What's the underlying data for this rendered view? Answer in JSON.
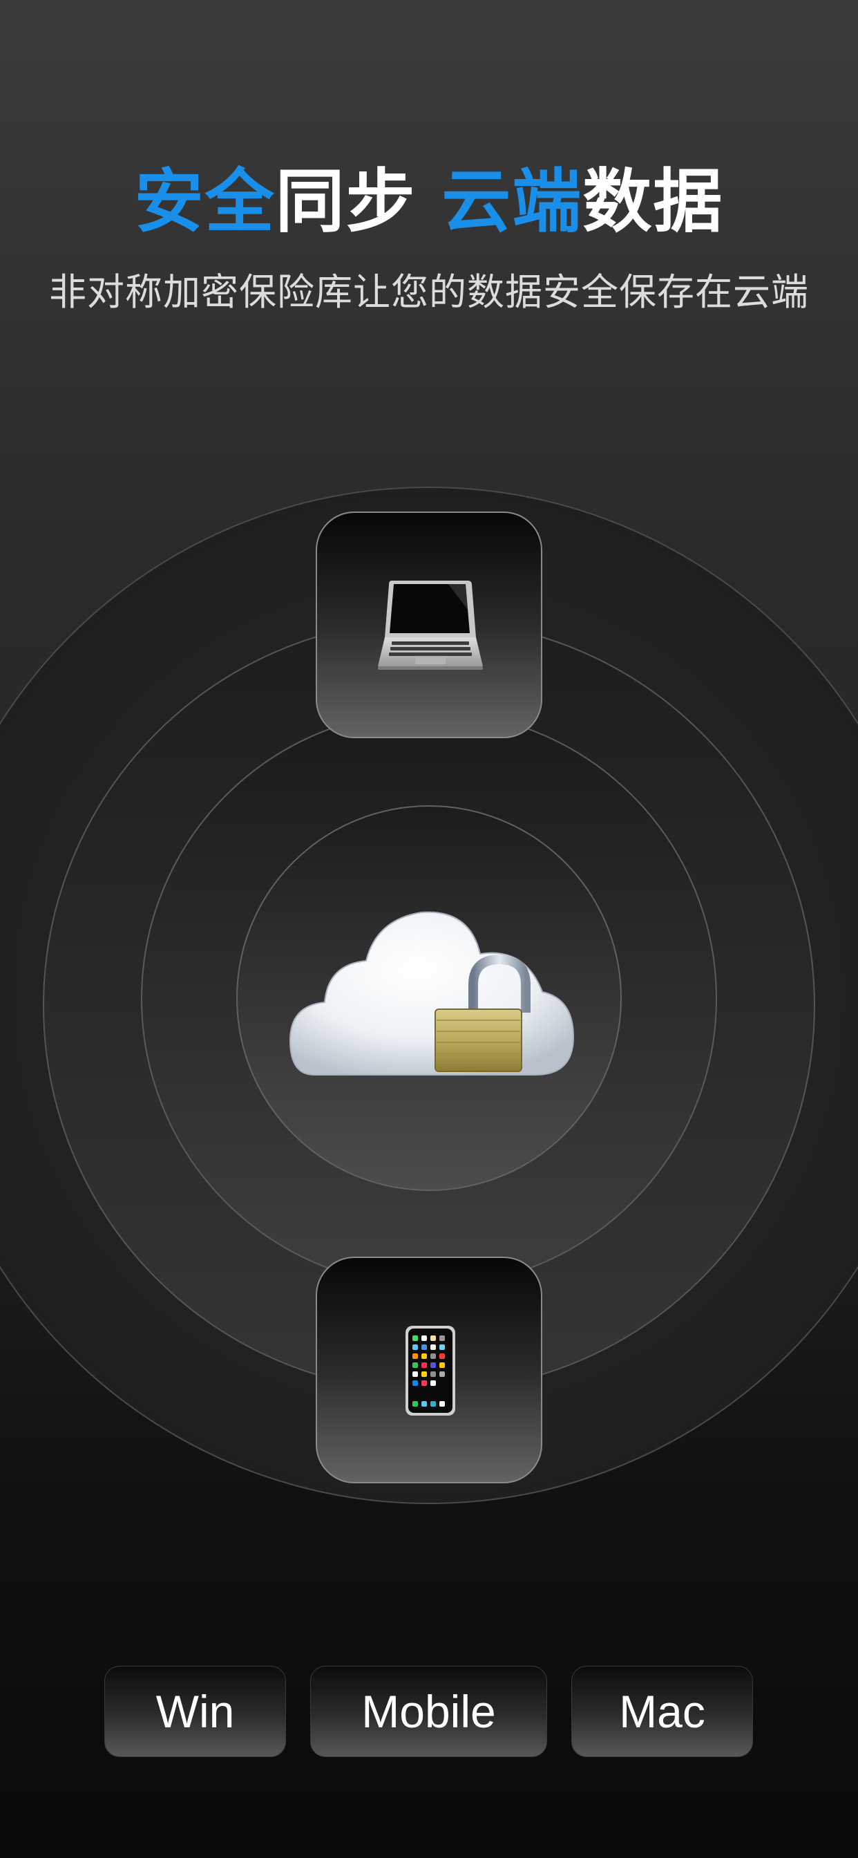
{
  "header": {
    "title_part1": "安全",
    "title_part2": "同步",
    "title_part3": "云端",
    "title_part4": "数据",
    "subtitle": "非对称加密保险库让您的数据安全保存在云端"
  },
  "colors": {
    "accent": "#1a8fea",
    "background_top": "#3b3b3b",
    "background_bottom": "#0a0a0a"
  },
  "illustration": {
    "top_device_icon": "laptop-icon",
    "center_icon": "cloud-with-lock-icon",
    "bottom_device_icon": "mobile-phone-icon"
  },
  "platforms": [
    {
      "label": "Win"
    },
    {
      "label": "Mobile"
    },
    {
      "label": "Mac"
    }
  ]
}
